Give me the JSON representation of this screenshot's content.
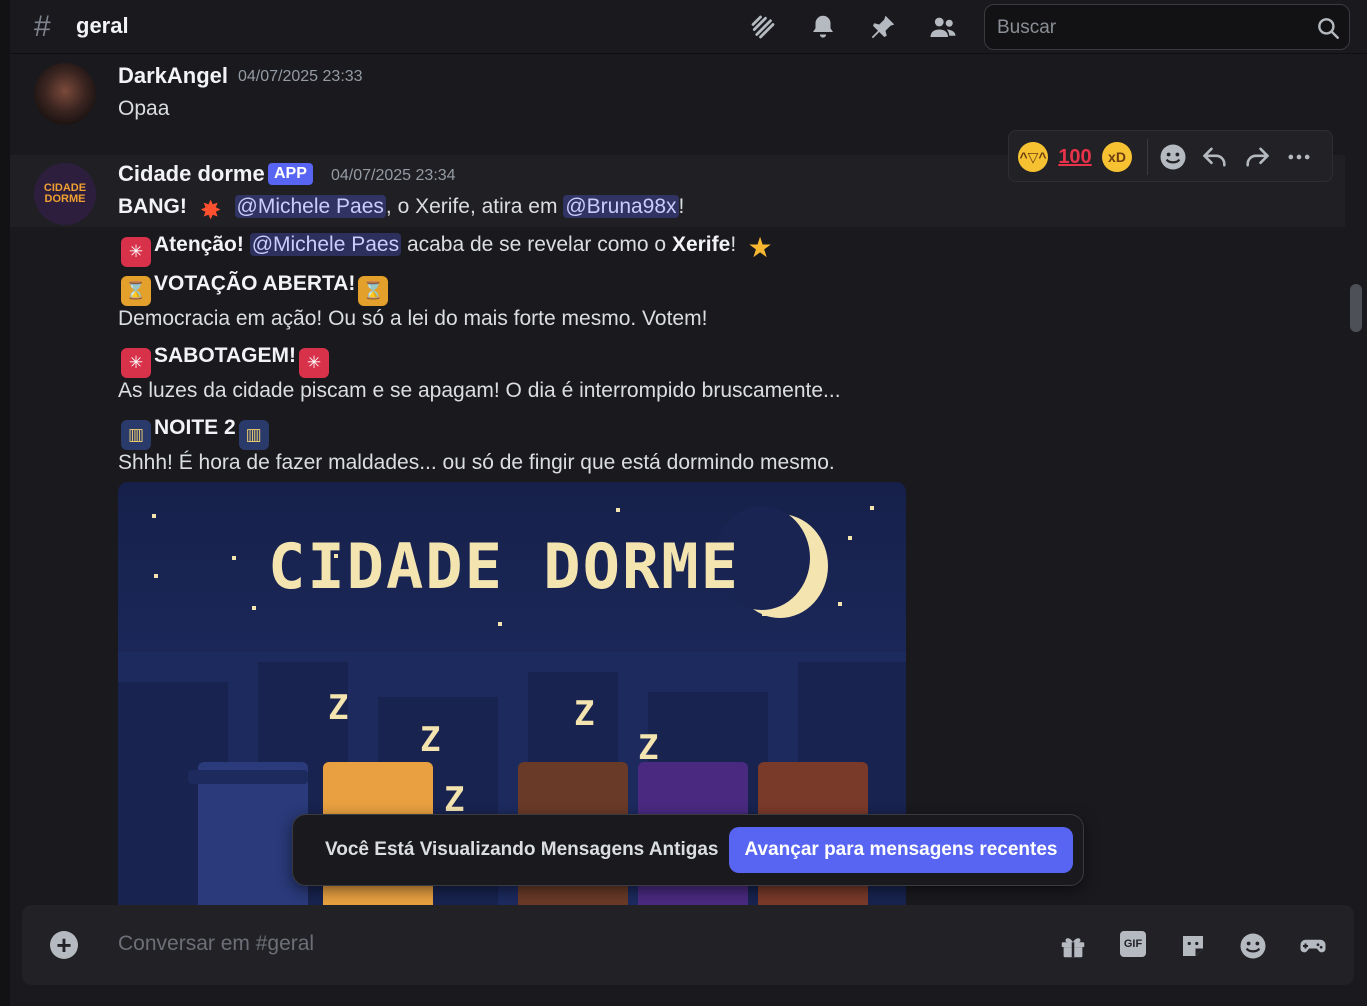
{
  "header": {
    "channel_hash": "#",
    "channel_name": "geral",
    "search_placeholder": "Buscar"
  },
  "messages": [
    {
      "username": "DarkAngel",
      "timestamp": "04/07/2025 23:33",
      "text": "Opaa"
    },
    {
      "username": "Cidade dorme",
      "badge": "APP",
      "timestamp": "04/07/2025 23:34",
      "avatar_text": "CIDADE DORME",
      "line1": {
        "bold": "BANG!",
        "mention1": "@Michele Paes",
        "middle": ", o Xerife, atira em",
        "mention2": "@Bruna98x",
        "end": "!"
      },
      "line2": {
        "bold": "Atenção!",
        "mention": "@Michele Paes",
        "middle": "acaba de se revelar como o",
        "bold2": "Xerife",
        "end": "!"
      },
      "line3": {
        "bold": "VOTAÇÃO ABERTA!"
      },
      "line4": "Democracia em ação! Ou só a lei do mais forte mesmo. Votem!",
      "line5": {
        "bold": "SABOTAGEM!"
      },
      "line6": "As luzes da cidade piscam e se apagam! O dia é interrompido bruscamente...",
      "line7": {
        "bold": "NOITE 2"
      },
      "line8": "Shhh! É hora de fazer maldades... ou só de fingir que está dormindo mesmo.",
      "image_title": "CIDADE DORME",
      "image_z": "Z"
    }
  ],
  "toolbar": {
    "hundred": "100"
  },
  "jump_banner": {
    "text": "Você Está Visualizando Mensagens Antigas",
    "button": "Avançar para mensagens recentes"
  },
  "composer": {
    "placeholder": "Conversar em #geral",
    "gif_label": "GIF"
  },
  "colors": {
    "background": "#1a1a1e",
    "accent": "#5865f2",
    "mention_bg": "#3a3f73"
  }
}
